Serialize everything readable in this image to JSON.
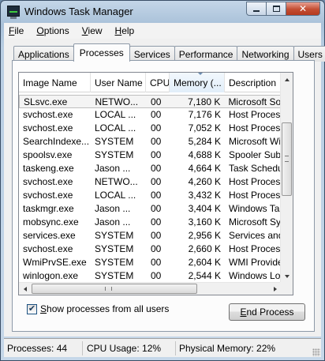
{
  "window": {
    "title": "Windows Task Manager"
  },
  "menu": {
    "items": [
      {
        "prefix": "",
        "accel": "F",
        "rest": "ile"
      },
      {
        "prefix": "",
        "accel": "O",
        "rest": "ptions"
      },
      {
        "prefix": "",
        "accel": "V",
        "rest": "iew"
      },
      {
        "prefix": "",
        "accel": "H",
        "rest": "elp"
      }
    ]
  },
  "tabs": {
    "applications": "Applications",
    "processes": "Processes",
    "services": "Services",
    "performance": "Performance",
    "networking": "Networking",
    "users": "Users",
    "active": "Processes"
  },
  "columns": {
    "image_name": "Image Name",
    "user_name": "User Name",
    "cpu": "CPU",
    "memory": "Memory (...",
    "description": "Description"
  },
  "rows": [
    {
      "image": "SLsvc.exe",
      "user": "NETWO...",
      "cpu": "00",
      "memory": "7,180 K",
      "desc": "Microsoft Software",
      "selected": true
    },
    {
      "image": "svchost.exe",
      "user": "LOCAL ...",
      "cpu": "00",
      "memory": "7,176 K",
      "desc": "Host Process for"
    },
    {
      "image": "svchost.exe",
      "user": "LOCAL ...",
      "cpu": "00",
      "memory": "7,052 K",
      "desc": "Host Process for"
    },
    {
      "image": "SearchIndexe...",
      "user": "SYSTEM",
      "cpu": "00",
      "memory": "5,284 K",
      "desc": "Microsoft Windows"
    },
    {
      "image": "spoolsv.exe",
      "user": "SYSTEM",
      "cpu": "00",
      "memory": "4,688 K",
      "desc": "Spooler SubSystem"
    },
    {
      "image": "taskeng.exe",
      "user": "Jason ...",
      "cpu": "00",
      "memory": "4,664 K",
      "desc": "Task Scheduler"
    },
    {
      "image": "svchost.exe",
      "user": "NETWO...",
      "cpu": "00",
      "memory": "4,260 K",
      "desc": "Host Process for"
    },
    {
      "image": "svchost.exe",
      "user": "LOCAL ...",
      "cpu": "00",
      "memory": "3,432 K",
      "desc": "Host Process for"
    },
    {
      "image": "taskmgr.exe",
      "user": "Jason ...",
      "cpu": "00",
      "memory": "3,404 K",
      "desc": "Windows Task"
    },
    {
      "image": "mobsync.exe",
      "user": "Jason ...",
      "cpu": "00",
      "memory": "3,160 K",
      "desc": "Microsoft Sync"
    },
    {
      "image": "services.exe",
      "user": "SYSTEM",
      "cpu": "00",
      "memory": "2,956 K",
      "desc": "Services and C"
    },
    {
      "image": "svchost.exe",
      "user": "SYSTEM",
      "cpu": "00",
      "memory": "2,660 K",
      "desc": "Host Process for"
    },
    {
      "image": "WmiPrvSE.exe",
      "user": "SYSTEM",
      "cpu": "00",
      "memory": "2,604 K",
      "desc": "WMI Provider"
    },
    {
      "image": "winlogon.exe",
      "user": "SYSTEM",
      "cpu": "00",
      "memory": "2,544 K",
      "desc": "Windows Logon"
    }
  ],
  "options": {
    "show_all_checked": true,
    "show_all_prefix": "",
    "show_all_accel": "S",
    "show_all_rest": "how processes from all users",
    "end_prefix": "",
    "end_accel": "E",
    "end_rest": "nd Process"
  },
  "status": {
    "processes": "Processes: 44",
    "cpu_usage": "CPU Usage: 12%",
    "physical_memory": "Physical Memory: 22%"
  },
  "icons": {
    "app": "task-manager-icon",
    "minimize": "minimize-icon",
    "maximize": "maximize-icon",
    "close": "close-icon",
    "check": "✔"
  }
}
